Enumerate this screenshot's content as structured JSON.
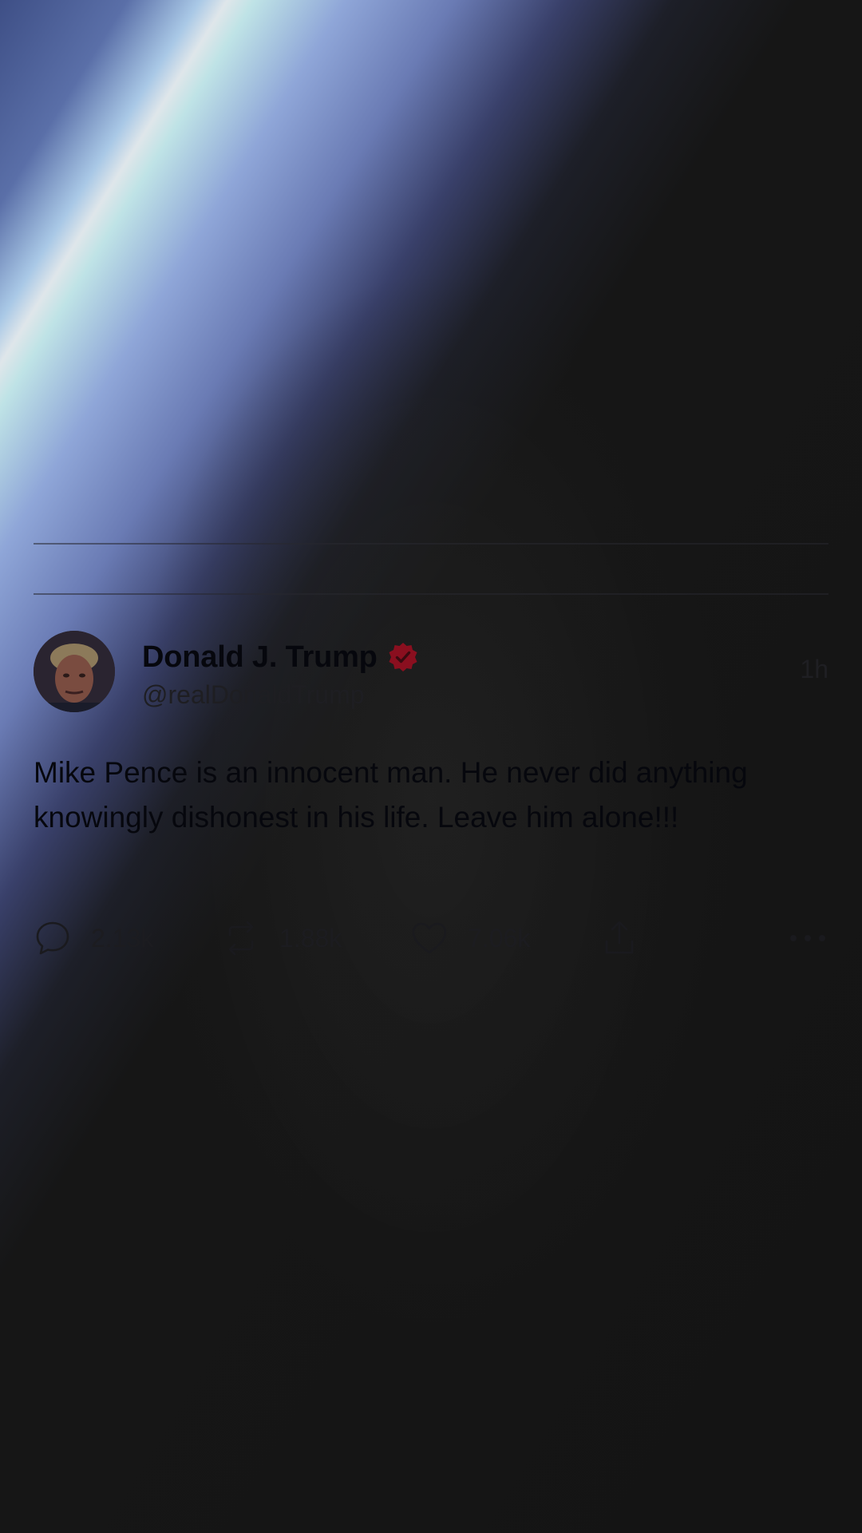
{
  "tweet": {
    "display_name": "Donald J. Trump",
    "handle": "@realDonaldTrump",
    "timestamp": "1h",
    "text": "Mike Pence is an innocent man. He never did anything knowingly dishonest in his life. Leave him alone!!!",
    "verified": true,
    "verified_badge_color": "#8a0f1f",
    "replies": "2.13k",
    "retweets": "1.88k",
    "likes": "7.06k"
  },
  "icons": {
    "avatar": "profile-photo",
    "verified": "verified-badge-icon",
    "reply": "comment-bubble-icon",
    "retweet": "retweet-arrows-icon",
    "like": "heart-icon",
    "share": "share-upload-icon",
    "more": "more-dots-icon"
  },
  "colors": {
    "background": "#141414",
    "text_primary": "#06070d",
    "text_secondary": "#1e1e22",
    "light_streak": "#dfe6ea",
    "glow_blue": "#6a7bb4"
  }
}
